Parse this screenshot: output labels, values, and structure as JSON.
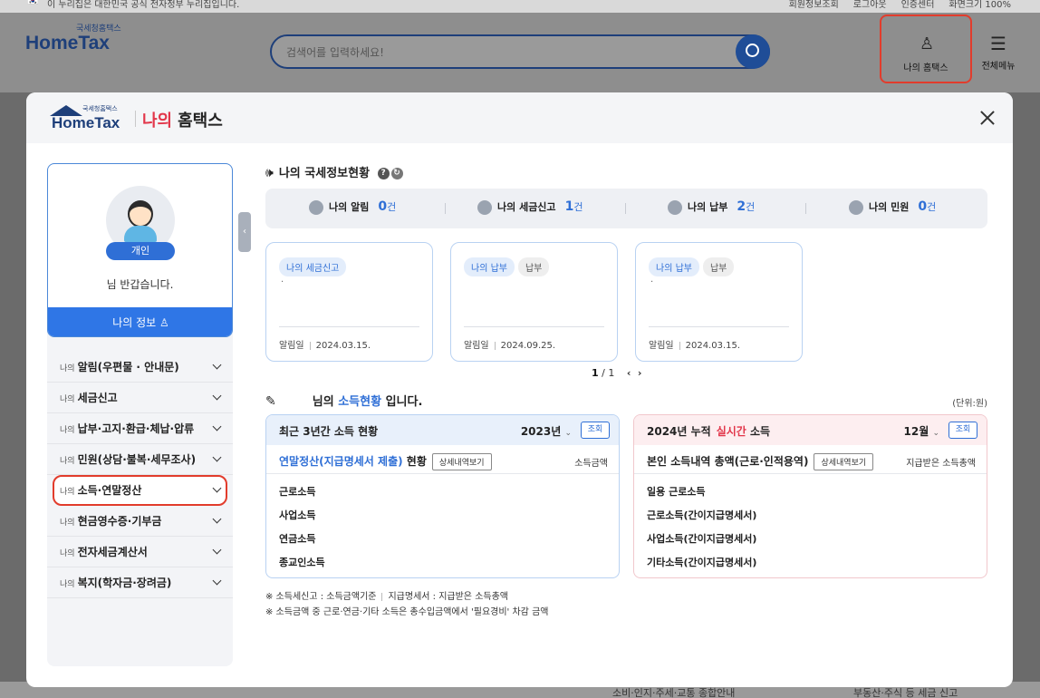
{
  "bg": {
    "gov_notice": "이 누리집은 대한민국 공식 전자정부 누리집입니다.",
    "top_links": [
      "회원정보조회",
      "로그아웃",
      "인증센터",
      "화면크기 100%"
    ],
    "logo_small": "국세청홈택스",
    "logo_big": "HomeTax",
    "search_placeholder": "검색어를 입력하세요!",
    "my_hometax": "나의 홈택스",
    "all_menu": "전체메뉴",
    "footer_1": "소비·인지·주세·교통 종합안내",
    "footer_2": "부동산·주식 등 세금 신고"
  },
  "modal": {
    "logo_small": "국세청홈택스",
    "logo_big": "HomeTax",
    "title_red": "나의",
    "title_black": "홈택스"
  },
  "profile": {
    "badge": "개인",
    "greeting": "님 반갑습니다.",
    "my_info": "나의 정보"
  },
  "menu": {
    "prefix": "나의",
    "items": [
      "알림(우편물 · 안내문)",
      "세금신고",
      "납부·고지·환급·체납·압류",
      "민원(상담·불복·세무조사)",
      "소득·연말정산",
      "현금영수증·기부금",
      "전자세금계산서",
      "복지(학자금·장려금)"
    ]
  },
  "status": {
    "title": "나의 국세정보현황",
    "summary": [
      {
        "label": "나의 알림",
        "num": "0",
        "unit": "건"
      },
      {
        "label": "나의 세금신고",
        "num": "1",
        "unit": "건"
      },
      {
        "label": "나의 납부",
        "num": "2",
        "unit": "건"
      },
      {
        "label": "나의 민원",
        "num": "0",
        "unit": "건"
      }
    ],
    "cards": [
      {
        "tag1": "나의 세금신고",
        "tag2": "",
        "dot": "·",
        "date_label": "알림일",
        "date": "2024.03.15."
      },
      {
        "tag1": "나의 납부",
        "tag2": "납부",
        "dot": "",
        "date_label": "알림일",
        "date": "2024.09.25."
      },
      {
        "tag1": "나의 납부",
        "tag2": "납부",
        "dot": "·",
        "date_label": "알림일",
        "date": "2024.03.15."
      }
    ],
    "pager_current": "1",
    "pager_total": "/ 1"
  },
  "income": {
    "title_pre": "님의",
    "title_blue": "소득현황",
    "title_post": "입니다.",
    "unit": "(단위:원)",
    "left": {
      "head": "최근 3년간 소득 현황",
      "year": "2023년",
      "look": "조회",
      "sub_blue": "연말정산(지급명세서 제출)",
      "sub_black": "현황",
      "detail": "상세내역보기",
      "amount_label": "소득금액",
      "rows": [
        "근로소득",
        "사업소득",
        "연금소득",
        "종교인소득"
      ]
    },
    "right": {
      "head": "2024년 누적",
      "head_red": "실시간",
      "head_post": "소득",
      "month": "12월",
      "look": "조회",
      "sub": "본인 소득내역 총액(근로·인적용역)",
      "detail": "상세내역보기",
      "amount_label": "지급받은 소득총액",
      "rows": [
        "일용 근로소득",
        "근로소득(간이지급명세서)",
        "사업소득(간이지급명세서)",
        "기타소득(간이지급명세서)"
      ]
    },
    "note1a": "※ 소득세신고 : 소득금액기준",
    "note1b": "지급명세서 : 지급받은 소득총액",
    "note2": "※ 소득금액 중 근로·연금·기타 소득은 총수입금액에서 '필요경비' 차감 금액"
  }
}
